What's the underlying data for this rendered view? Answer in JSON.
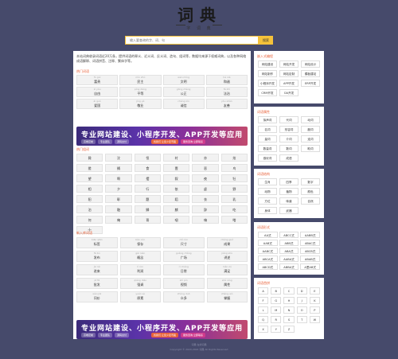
{
  "logo": {
    "main": "词典",
    "sub": "字 词 典"
  },
  "search": {
    "placeholder": "输入要查询的字、词、句",
    "button": "搜索"
  },
  "intro": "本站词典收录词语近20万条，提供词语的释义、近义词、反义词、造句、组词等，数据均来源于权威词典，以及各种网络成语解释、词语拼音、注释、繁体字等。",
  "hot_words": {
    "title": "热门词语",
    "items": [
      {
        "py": "fù guì",
        "hz": "富贵"
      },
      {
        "py": "mín zhǔ",
        "hz": "民主"
      },
      {
        "py": "wén míng",
        "hz": "文明"
      },
      {
        "py": "hé xié",
        "hz": "和谐"
      },
      {
        "py": "zì yóu",
        "hz": "自由"
      },
      {
        "py": "píng děng",
        "hz": "平等"
      },
      {
        "py": "gōng zhèng",
        "hz": "公正"
      },
      {
        "py": "fǎ zhì",
        "hz": "法治"
      },
      {
        "py": "ài guó",
        "hz": "爱国"
      },
      {
        "py": "jìng yè",
        "hz": "敬业"
      },
      {
        "py": "chéng xìn",
        "hz": "诚信"
      },
      {
        "py": "yǒu shàn",
        "hz": "友善"
      }
    ]
  },
  "banner": {
    "title": "专业网站建设、小程序开发、APP开发等应用",
    "tags": [
      "高端定制",
      "专业团队",
      "源码交付"
    ],
    "promo": "找我们 让您少走弯路",
    "promo2": "服务咨询 立即联系"
  },
  "hot_chars": {
    "title": "热门组词",
    "items": [
      "鬓",
      "汶",
      "怛",
      "衬",
      "亦",
      "炫",
      "搓",
      "捅",
      "食",
      "壹",
      "恶",
      "鸟",
      "望",
      "啊",
      "摆",
      "叙",
      "夜",
      "牡",
      "相",
      "夕",
      "行",
      "依",
      "虚",
      "野",
      "阳",
      "彰",
      "题",
      "蹈",
      "衣",
      "乳",
      "泊",
      "融",
      "鳞",
      "麒",
      "辞",
      "吃",
      "何",
      "俺",
      "哥",
      "咽",
      "嗨",
      "嗒",
      "+"
    ]
  },
  "recent_words": {
    "title": "新入库词语",
    "items": [
      {
        "py": "biāo qiān",
        "hz": "标签"
      },
      {
        "py": "bǎo cún",
        "hz": "保存"
      },
      {
        "py": "chǐ cùn",
        "hz": "尺寸"
      },
      {
        "py": "chéng guǒ",
        "hz": "成果"
      },
      {
        "py": "fā bù",
        "hz": "发布"
      },
      {
        "py": "gài niàn",
        "hz": "概念"
      },
      {
        "py": "guǎng chǎng",
        "hz": "广场"
      },
      {
        "py": "jiǎng shù",
        "hz": "讲述"
      },
      {
        "py": "jìn lái",
        "hz": "进来"
      },
      {
        "py": "lì rùn",
        "hz": "利润"
      },
      {
        "py": "rì cháng",
        "hz": "日常"
      },
      {
        "py": "mǎn zú",
        "hz": "满足"
      },
      {
        "py": "pī fā",
        "hz": "批发"
      },
      {
        "py": "qiáng diào",
        "hz": "强调"
      },
      {
        "py": "shì pín",
        "hz": "视频"
      },
      {
        "py": "shǔ xìng",
        "hz": "属性"
      },
      {
        "py": "wèn jiā",
        "hz": "问价"
      },
      {
        "py": "yuán sù",
        "hz": "原素"
      },
      {
        "py": "zhòng duō",
        "hz": "众多"
      },
      {
        "py": "zhǎng wò",
        "hz": "掌握"
      }
    ]
  },
  "side_ads": {
    "title": "嵌入式编程",
    "items": [
      "网站建设",
      "网站开发",
      "网站设计",
      "网站制作",
      "网站定制",
      "模板建站",
      "小程序开发",
      "APP开发",
      "ERP开发",
      "CRM开发",
      "OA开发"
    ]
  },
  "side_idioms": {
    "title": "词语属性",
    "items": [
      "拟声词",
      "代词",
      "动词",
      "名词",
      "形容词",
      "副词",
      "量词",
      "介词",
      "连词",
      "数量词",
      "数词",
      "助词",
      "感叹词",
      "成语"
    ]
  },
  "side_structure": {
    "title": "词语结构",
    "items": [
      "生肖",
      "四季",
      "数字",
      "动物",
      "植物",
      "颜色",
      "方位",
      "味道",
      "自然",
      "身体",
      "武器"
    ]
  },
  "side_forms": {
    "title": "词语形式",
    "items": [
      "AA式",
      "ABCC式",
      "AABB式",
      "AAB式",
      "ABB式",
      "ABAC式",
      "AABC式",
      "ABA式",
      "ABCB式",
      "ABCA式",
      "AABA式",
      "ABAB式",
      "ABCD式",
      "ABBA式",
      "A里AB式"
    ]
  },
  "side_alpha": {
    "title": "词语首拼",
    "items": [
      "A",
      "B",
      "C",
      "D",
      "E",
      "F",
      "G",
      "H",
      "J",
      "K",
      "L",
      "M",
      "N",
      "O",
      "P",
      "Q",
      "R",
      "S",
      "T",
      "W",
      "X",
      "Y",
      "Z"
    ]
  },
  "footer": {
    "line1": "词典 在线词典",
    "line2": "Copyright © 2020-2024 词典 All Rights Reserved"
  },
  "colors": {
    "background": "#464a6b",
    "accent": "#e8613a",
    "search": "#f5c23a"
  }
}
